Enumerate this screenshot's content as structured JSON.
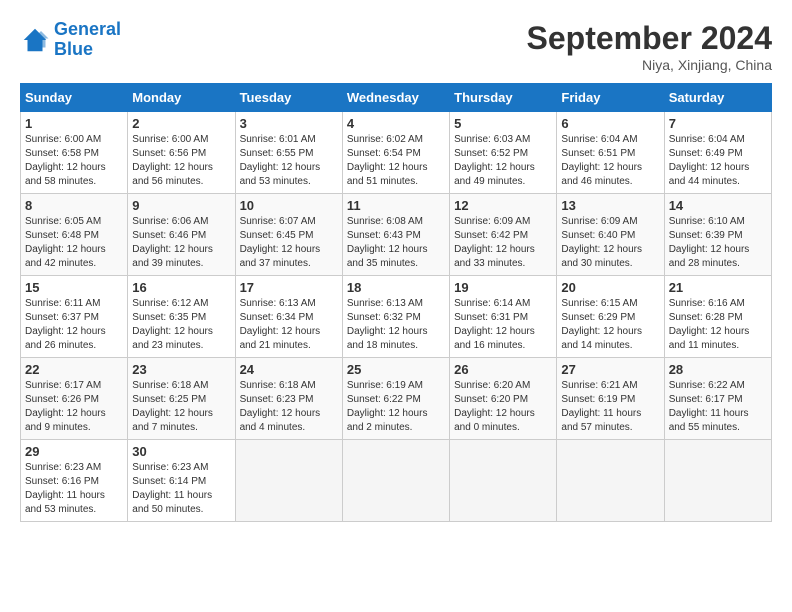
{
  "header": {
    "logo_line1": "General",
    "logo_line2": "Blue",
    "month": "September 2024",
    "location": "Niya, Xinjiang, China"
  },
  "days_of_week": [
    "Sunday",
    "Monday",
    "Tuesday",
    "Wednesday",
    "Thursday",
    "Friday",
    "Saturday"
  ],
  "weeks": [
    [
      {
        "day": "1",
        "sunrise": "6:00 AM",
        "sunset": "6:58 PM",
        "daylight": "12 hours and 58 minutes."
      },
      {
        "day": "2",
        "sunrise": "6:00 AM",
        "sunset": "6:56 PM",
        "daylight": "12 hours and 56 minutes."
      },
      {
        "day": "3",
        "sunrise": "6:01 AM",
        "sunset": "6:55 PM",
        "daylight": "12 hours and 53 minutes."
      },
      {
        "day": "4",
        "sunrise": "6:02 AM",
        "sunset": "6:54 PM",
        "daylight": "12 hours and 51 minutes."
      },
      {
        "day": "5",
        "sunrise": "6:03 AM",
        "sunset": "6:52 PM",
        "daylight": "12 hours and 49 minutes."
      },
      {
        "day": "6",
        "sunrise": "6:04 AM",
        "sunset": "6:51 PM",
        "daylight": "12 hours and 46 minutes."
      },
      {
        "day": "7",
        "sunrise": "6:04 AM",
        "sunset": "6:49 PM",
        "daylight": "12 hours and 44 minutes."
      }
    ],
    [
      {
        "day": "8",
        "sunrise": "6:05 AM",
        "sunset": "6:48 PM",
        "daylight": "12 hours and 42 minutes."
      },
      {
        "day": "9",
        "sunrise": "6:06 AM",
        "sunset": "6:46 PM",
        "daylight": "12 hours and 39 minutes."
      },
      {
        "day": "10",
        "sunrise": "6:07 AM",
        "sunset": "6:45 PM",
        "daylight": "12 hours and 37 minutes."
      },
      {
        "day": "11",
        "sunrise": "6:08 AM",
        "sunset": "6:43 PM",
        "daylight": "12 hours and 35 minutes."
      },
      {
        "day": "12",
        "sunrise": "6:09 AM",
        "sunset": "6:42 PM",
        "daylight": "12 hours and 33 minutes."
      },
      {
        "day": "13",
        "sunrise": "6:09 AM",
        "sunset": "6:40 PM",
        "daylight": "12 hours and 30 minutes."
      },
      {
        "day": "14",
        "sunrise": "6:10 AM",
        "sunset": "6:39 PM",
        "daylight": "12 hours and 28 minutes."
      }
    ],
    [
      {
        "day": "15",
        "sunrise": "6:11 AM",
        "sunset": "6:37 PM",
        "daylight": "12 hours and 26 minutes."
      },
      {
        "day": "16",
        "sunrise": "6:12 AM",
        "sunset": "6:35 PM",
        "daylight": "12 hours and 23 minutes."
      },
      {
        "day": "17",
        "sunrise": "6:13 AM",
        "sunset": "6:34 PM",
        "daylight": "12 hours and 21 minutes."
      },
      {
        "day": "18",
        "sunrise": "6:13 AM",
        "sunset": "6:32 PM",
        "daylight": "12 hours and 18 minutes."
      },
      {
        "day": "19",
        "sunrise": "6:14 AM",
        "sunset": "6:31 PM",
        "daylight": "12 hours and 16 minutes."
      },
      {
        "day": "20",
        "sunrise": "6:15 AM",
        "sunset": "6:29 PM",
        "daylight": "12 hours and 14 minutes."
      },
      {
        "day": "21",
        "sunrise": "6:16 AM",
        "sunset": "6:28 PM",
        "daylight": "12 hours and 11 minutes."
      }
    ],
    [
      {
        "day": "22",
        "sunrise": "6:17 AM",
        "sunset": "6:26 PM",
        "daylight": "12 hours and 9 minutes."
      },
      {
        "day": "23",
        "sunrise": "6:18 AM",
        "sunset": "6:25 PM",
        "daylight": "12 hours and 7 minutes."
      },
      {
        "day": "24",
        "sunrise": "6:18 AM",
        "sunset": "6:23 PM",
        "daylight": "12 hours and 4 minutes."
      },
      {
        "day": "25",
        "sunrise": "6:19 AM",
        "sunset": "6:22 PM",
        "daylight": "12 hours and 2 minutes."
      },
      {
        "day": "26",
        "sunrise": "6:20 AM",
        "sunset": "6:20 PM",
        "daylight": "12 hours and 0 minutes."
      },
      {
        "day": "27",
        "sunrise": "6:21 AM",
        "sunset": "6:19 PM",
        "daylight": "11 hours and 57 minutes."
      },
      {
        "day": "28",
        "sunrise": "6:22 AM",
        "sunset": "6:17 PM",
        "daylight": "11 hours and 55 minutes."
      }
    ],
    [
      {
        "day": "29",
        "sunrise": "6:23 AM",
        "sunset": "6:16 PM",
        "daylight": "11 hours and 53 minutes."
      },
      {
        "day": "30",
        "sunrise": "6:23 AM",
        "sunset": "6:14 PM",
        "daylight": "11 hours and 50 minutes."
      },
      null,
      null,
      null,
      null,
      null
    ]
  ]
}
